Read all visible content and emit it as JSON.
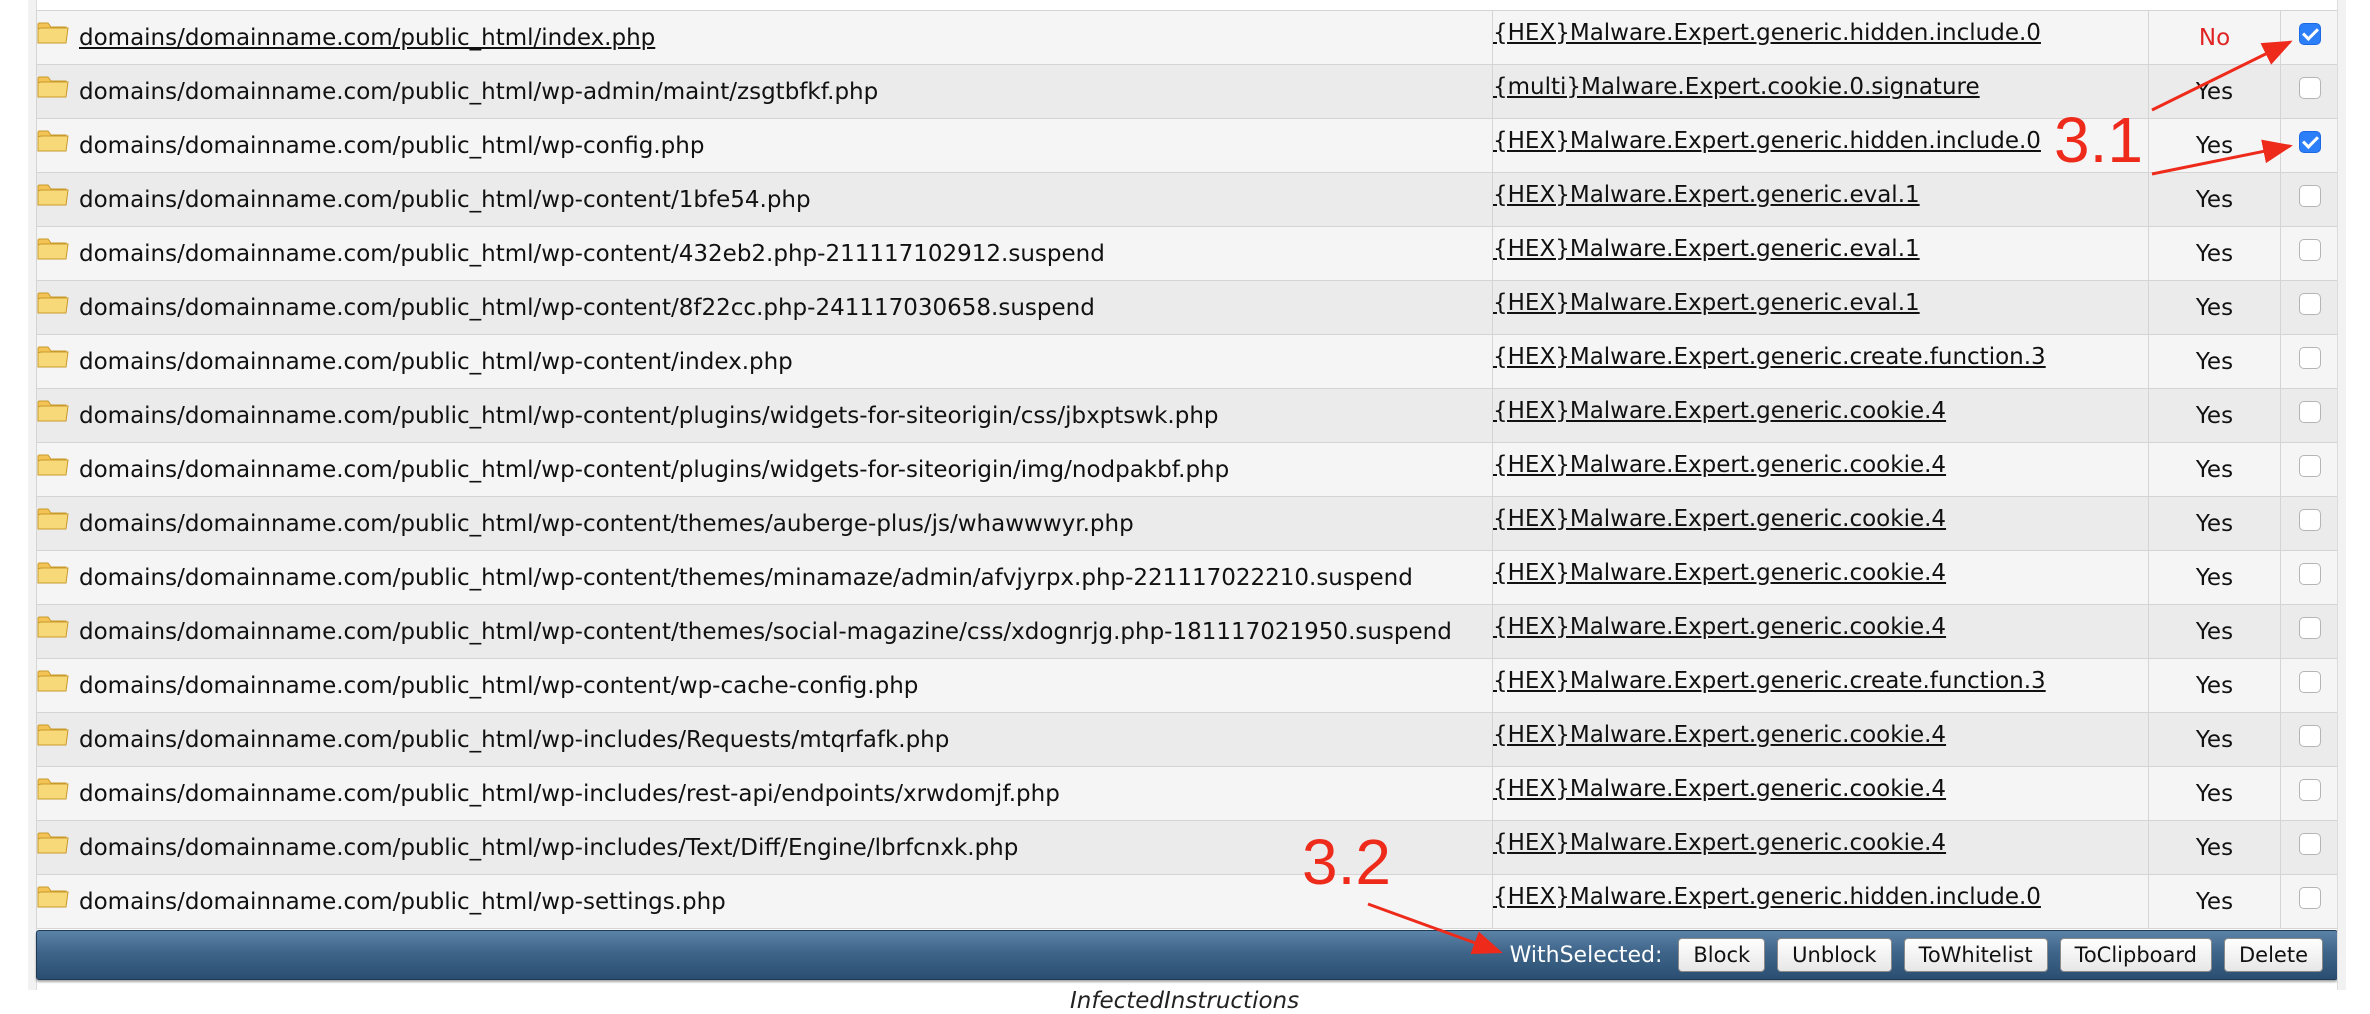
{
  "rows": [
    {
      "path": "domains/domainname.com/public_html/index.php",
      "signature": "{HEX}Malware.Expert.generic.hidden.include.0",
      "flag": "No",
      "checked": true,
      "path_link": true
    },
    {
      "path": "domains/domainname.com/public_html/wp-admin/maint/zsgtbfkf.php",
      "signature": "{multi}Malware.Expert.cookie.0.signature",
      "flag": "Yes",
      "checked": false
    },
    {
      "path": "domains/domainname.com/public_html/wp-config.php",
      "signature": "{HEX}Malware.Expert.generic.hidden.include.0",
      "flag": "Yes",
      "checked": true
    },
    {
      "path": "domains/domainname.com/public_html/wp-content/1bfe54.php",
      "signature": "{HEX}Malware.Expert.generic.eval.1",
      "flag": "Yes",
      "checked": false
    },
    {
      "path": "domains/domainname.com/public_html/wp-content/432eb2.php-211117102912.suspend",
      "signature": "{HEX}Malware.Expert.generic.eval.1",
      "flag": "Yes",
      "checked": false
    },
    {
      "path": "domains/domainname.com/public_html/wp-content/8f22cc.php-241117030658.suspend",
      "signature": "{HEX}Malware.Expert.generic.eval.1",
      "flag": "Yes",
      "checked": false
    },
    {
      "path": "domains/domainname.com/public_html/wp-content/index.php",
      "signature": "{HEX}Malware.Expert.generic.create.function.3",
      "flag": "Yes",
      "checked": false
    },
    {
      "path": "domains/domainname.com/public_html/wp-content/plugins/widgets-for-siteorigin/css/jbxptswk.php",
      "signature": "{HEX}Malware.Expert.generic.cookie.4",
      "flag": "Yes",
      "checked": false
    },
    {
      "path": "domains/domainname.com/public_html/wp-content/plugins/widgets-for-siteorigin/img/nodpakbf.php",
      "signature": "{HEX}Malware.Expert.generic.cookie.4",
      "flag": "Yes",
      "checked": false
    },
    {
      "path": "domains/domainname.com/public_html/wp-content/themes/auberge-plus/js/whawwwyr.php",
      "signature": "{HEX}Malware.Expert.generic.cookie.4",
      "flag": "Yes",
      "checked": false
    },
    {
      "path": "domains/domainname.com/public_html/wp-content/themes/minamaze/admin/afvjyrpx.php-221117022210.suspend",
      "signature": "{HEX}Malware.Expert.generic.cookie.4",
      "flag": "Yes",
      "checked": false
    },
    {
      "path": "domains/domainname.com/public_html/wp-content/themes/social-magazine/css/xdognrjg.php-181117021950.suspend",
      "signature": "{HEX}Malware.Expert.generic.cookie.4",
      "flag": "Yes",
      "checked": false
    },
    {
      "path": "domains/domainname.com/public_html/wp-content/wp-cache-config.php",
      "signature": "{HEX}Malware.Expert.generic.create.function.3",
      "flag": "Yes",
      "checked": false
    },
    {
      "path": "domains/domainname.com/public_html/wp-includes/Requests/mtqrfafk.php",
      "signature": "{HEX}Malware.Expert.generic.cookie.4",
      "flag": "Yes",
      "checked": false
    },
    {
      "path": "domains/domainname.com/public_html/wp-includes/rest-api/endpoints/xrwdomjf.php",
      "signature": "{HEX}Malware.Expert.generic.cookie.4",
      "flag": "Yes",
      "checked": false
    },
    {
      "path": "domains/domainname.com/public_html/wp-includes/Text/Diff/Engine/lbrfcnxk.php",
      "signature": "{HEX}Malware.Expert.generic.cookie.4",
      "flag": "Yes",
      "checked": false
    },
    {
      "path": "domains/domainname.com/public_html/wp-settings.php",
      "signature": "{HEX}Malware.Expert.generic.hidden.include.0",
      "flag": "Yes",
      "checked": false
    }
  ],
  "actionbar": {
    "label": "WithSelected:",
    "buttons": [
      "Block",
      "Unblock",
      "ToWhitelist",
      "ToClipboard",
      "Delete"
    ]
  },
  "footer_text": "InfectedInstructions",
  "annotations": {
    "label_1": "3.1",
    "label_2": "3.2"
  },
  "icons": {
    "row": "folder-icon",
    "checkbox": "checkbox"
  },
  "colors": {
    "flag_no": "#e02424",
    "annotation": "#ee2a1b",
    "checkbox_checked": "#2d7ff9",
    "folder": "#f3c455",
    "bar_top": "#5b82a7",
    "bar_bottom": "#2a4e71"
  }
}
